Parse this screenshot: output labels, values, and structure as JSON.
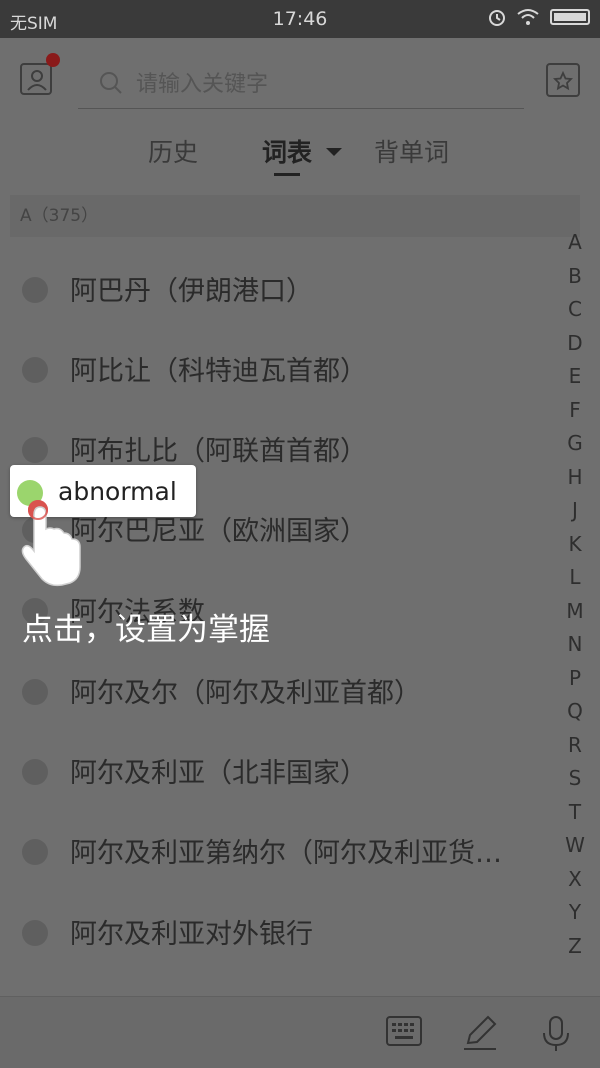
{
  "status": {
    "carrier": "无SIM",
    "time": "17:46"
  },
  "search": {
    "placeholder": "请输入关键字"
  },
  "tabs": {
    "history": "历史",
    "wordlist": "词表",
    "recite": "背单词"
  },
  "section": {
    "header": "A（375）"
  },
  "words": [
    "阿巴丹（伊朗港口）",
    "阿比让（科特迪瓦首都）",
    "阿布扎比（阿联酋首都）",
    "阿尔巴尼亚（欧洲国家）",
    "阿尔法系数",
    "阿尔及尔（阿尔及利亚首都）",
    "阿尔及利亚（北非国家）",
    "阿尔及利亚第纳尔（阿尔及利亚货…",
    "阿尔及利亚对外银行"
  ],
  "alphabet": [
    "A",
    "B",
    "C",
    "D",
    "E",
    "F",
    "G",
    "H",
    "J",
    "K",
    "L",
    "M",
    "N",
    "P",
    "Q",
    "R",
    "S",
    "T",
    "W",
    "X",
    "Y",
    "Z"
  ],
  "tooltip": {
    "word": "abnormal"
  },
  "hint": {
    "text": "点击，设置为掌握"
  },
  "icons": {
    "profile": "profile-icon",
    "search": "search-icon",
    "favorites": "star-folder-icon",
    "keyboard": "keyboard-icon",
    "pen": "pen-icon",
    "mic": "microphone-icon"
  },
  "colors": {
    "overlay": "#6f6f6f",
    "green": "#9bd56d",
    "badge": "#8a1a1a"
  }
}
